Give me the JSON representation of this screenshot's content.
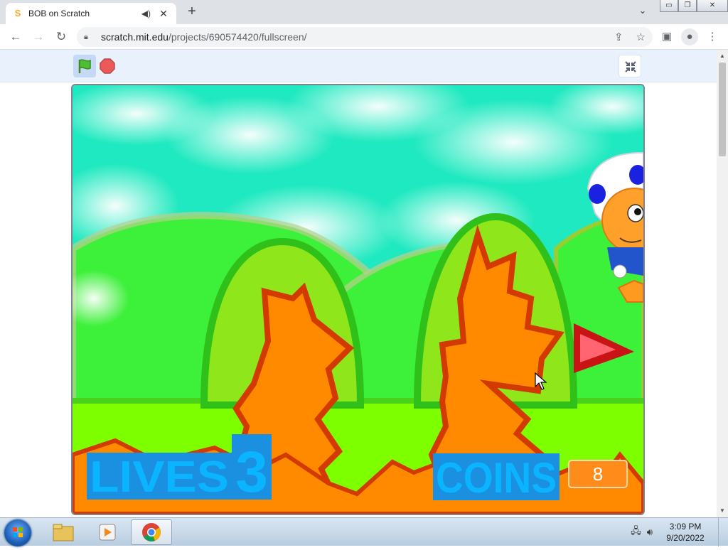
{
  "browser": {
    "tab_title": "BOB on Scratch",
    "tab_close": "✕",
    "new_tab": "+",
    "url_host": "scratch.mit.edu",
    "url_path": "/projects/690574420/fullscreen/"
  },
  "window_controls": {
    "minimize": "▭",
    "restore": "❐",
    "close": "✕"
  },
  "game": {
    "lives_label": "LIVES",
    "lives_value": "3",
    "coins_label": "COINS",
    "coins_value": "8"
  },
  "taskbar": {
    "time": "3:09 PM",
    "date": "9/20/2022"
  },
  "colors": {
    "hud_text": "#0ab4ff",
    "coin_box": "#ff8c1a",
    "grass": "#7dff00",
    "bush": "#8fe61a",
    "dirt": "#ff8a00"
  }
}
